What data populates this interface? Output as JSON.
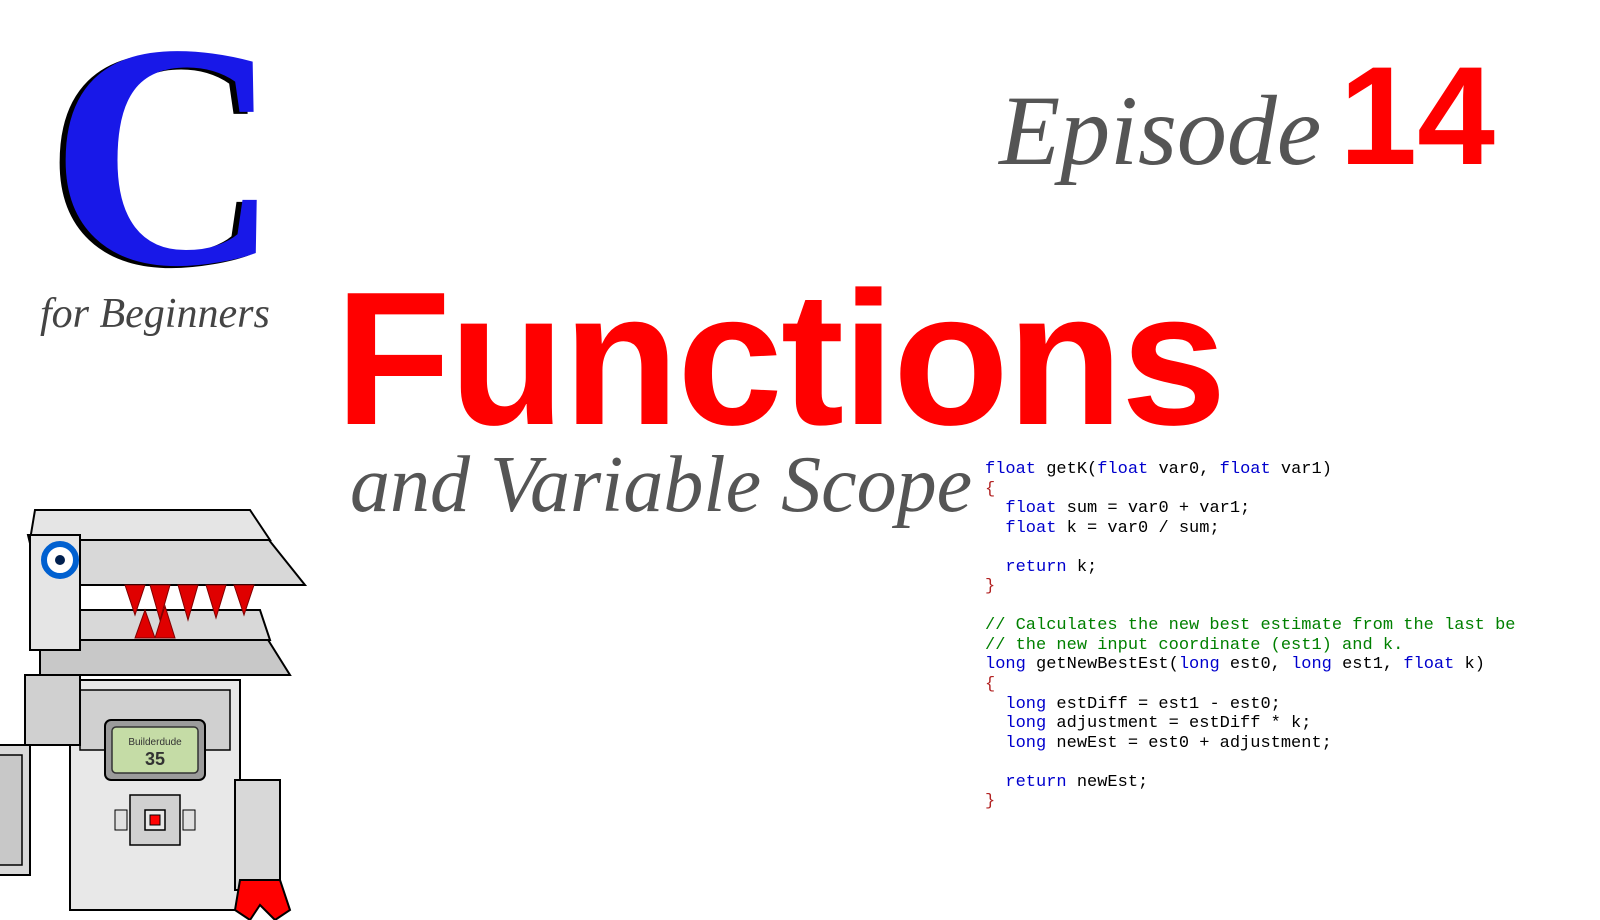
{
  "logo": {
    "letter": "C",
    "subtitle": "for Beginners"
  },
  "episode": {
    "label": "Episode",
    "number": "14"
  },
  "title": "Functions",
  "subtitle": "and Variable Scope",
  "robot": {
    "display_line1": "Builderdude",
    "display_line2": "35"
  },
  "code": {
    "l1a": "float",
    "l1b": " getK(",
    "l1c": "float",
    "l1d": " var0, ",
    "l1e": "float",
    "l1f": " var1)",
    "l2": "{",
    "l3a": "  float",
    "l3b": " sum = var0 + var1;",
    "l4a": "  float",
    "l4b": " k = var0 / sum;",
    "l5": "",
    "l6a": "  return",
    "l6b": " k;",
    "l7": "}",
    "l8": "",
    "l9": "// Calculates the new best estimate from the last be",
    "l10": "// the new input coordinate (est1) and k.",
    "l11a": "long",
    "l11b": " getNewBestEst(",
    "l11c": "long",
    "l11d": " est0, ",
    "l11e": "long",
    "l11f": " est1, ",
    "l11g": "float",
    "l11h": " k)",
    "l12": "{",
    "l13a": "  long",
    "l13b": " estDiff = est1 - est0;",
    "l14a": "  long",
    "l14b": " adjustment = estDiff * k;",
    "l15a": "  long",
    "l15b": " newEst = est0 + adjustment;",
    "l16": "",
    "l17a": "  return",
    "l17b": " newEst;",
    "l18": "}"
  }
}
